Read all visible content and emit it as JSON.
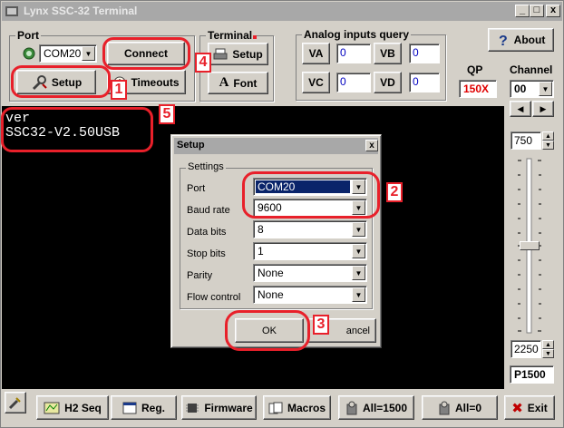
{
  "window": {
    "title": "Lynx SSC-32 Terminal"
  },
  "titlebar_buttons": [
    "_",
    "□",
    "x"
  ],
  "port": {
    "group_label": "Port",
    "com_value": "COM20",
    "connect_label": "Connect",
    "setup_label": "Setup",
    "timeouts_label": "Timeouts"
  },
  "terminal_group": {
    "group_label": "Terminal",
    "setup_label": "Setup",
    "font_label": "Font"
  },
  "analog": {
    "group_label": "Analog inputs query",
    "inputs": [
      {
        "label": "VA",
        "value": "0"
      },
      {
        "label": "VB",
        "value": "0"
      },
      {
        "label": "VC",
        "value": "0"
      },
      {
        "label": "VD",
        "value": "0"
      }
    ]
  },
  "about_label": "About",
  "qp": {
    "label": "QP",
    "value": "150X"
  },
  "channel": {
    "label": "Channel",
    "value": "00"
  },
  "terminal_lines": [
    "ver",
    "SSC32-V2.50USB"
  ],
  "slider": {
    "top_value": "750",
    "bottom_value": "2250",
    "pulse_label": "P1500",
    "level": 0.5
  },
  "setup_dialog": {
    "title": "Setup",
    "close_label": "x",
    "settings_label": "Settings",
    "fields": [
      {
        "label": "Port",
        "value": "COM20"
      },
      {
        "label": "Baud rate",
        "value": "9600"
      },
      {
        "label": "Data bits",
        "value": "8"
      },
      {
        "label": "Stop bits",
        "value": "1"
      },
      {
        "label": "Parity",
        "value": "None"
      },
      {
        "label": "Flow control",
        "value": "None"
      }
    ],
    "ok_label": "OK",
    "cancel_label": "ancel"
  },
  "annotations": [
    "1",
    "2",
    "3",
    "4",
    "5"
  ],
  "bottom_bar": {
    "buttons": [
      {
        "label": "H2 Seq"
      },
      {
        "label": "Reg."
      },
      {
        "label": "Firmware"
      },
      {
        "label": "Macros"
      },
      {
        "label": "All=1500"
      },
      {
        "label": "All=0"
      },
      {
        "label": "Exit"
      }
    ]
  },
  "colors": {
    "annotation": "#e8202a",
    "qp_text": "#e00000",
    "terminal_bg": "#000000",
    "input_text": "#0000c0"
  }
}
